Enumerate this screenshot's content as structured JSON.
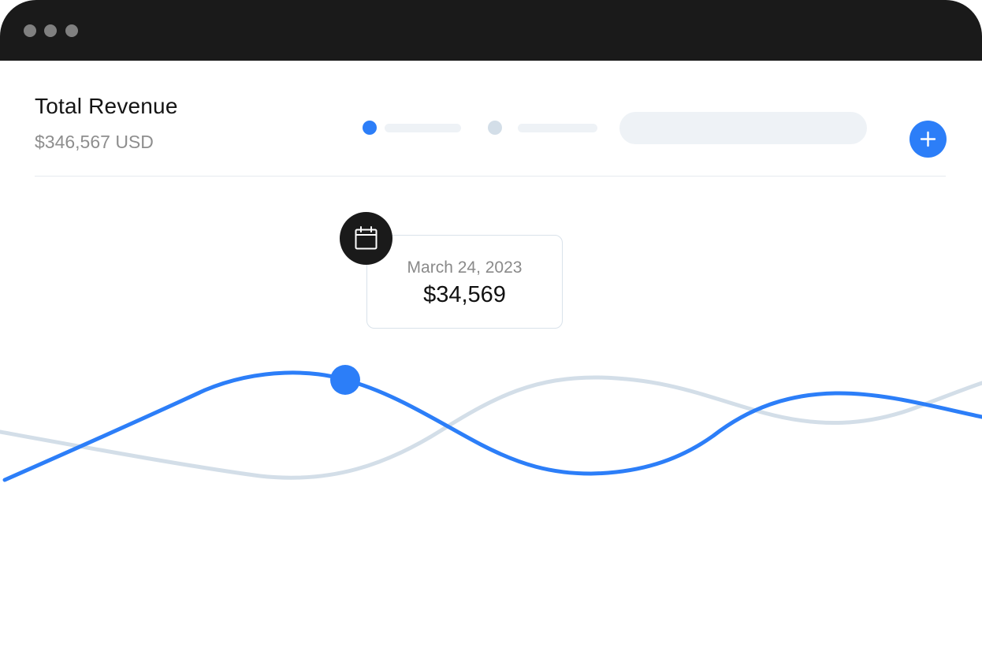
{
  "window": {
    "controls": [
      "close",
      "minimize",
      "maximize"
    ],
    "titlebar_color": "#1a1a1a"
  },
  "header": {
    "title": "Total Revenue",
    "subtitle": "$346,567 USD"
  },
  "legend": [
    {
      "color": "#2c7ef8"
    },
    {
      "color": "#d3dee8"
    }
  ],
  "search": {
    "placeholder": ""
  },
  "add_button": {
    "icon": "plus-icon",
    "color": "#2c7ef8"
  },
  "tooltip": {
    "icon": "calendar-icon",
    "date": "March 24, 2023",
    "value": "$34,569"
  },
  "colors": {
    "accent": "#2c7ef8",
    "secondary_series": "#d3dee8",
    "text_primary": "#141414",
    "text_muted": "#8e8e8e"
  }
}
